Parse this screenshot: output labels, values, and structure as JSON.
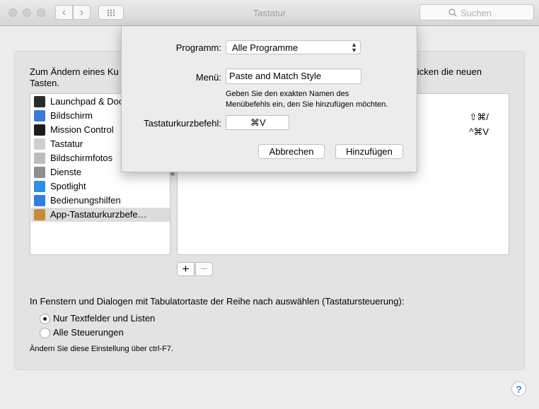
{
  "window": {
    "title": "Tastatur",
    "search_placeholder": "Suchen",
    "back_glyph": "‹",
    "forward_glyph": "›"
  },
  "intro": {
    "text_left": "Zum Ändern eines Ku",
    "text_second_line": "Tasten.",
    "text_right": "drücken die neuen"
  },
  "categories": [
    {
      "label": "Launchpad & Doc",
      "icon": "launchpad-dock-icon",
      "color": "#2b2b2b"
    },
    {
      "label": "Bildschirm",
      "icon": "display-icon",
      "color": "#3a7bd5"
    },
    {
      "label": "Mission Control",
      "icon": "mission-control-icon",
      "color": "#1c1c1c"
    },
    {
      "label": "Tastatur",
      "icon": "keyboard-icon",
      "color": "#cfcfcf"
    },
    {
      "label": "Bildschirmfotos",
      "icon": "screenshot-icon",
      "color": "#bdbdbd"
    },
    {
      "label": "Dienste",
      "icon": "services-gear-icon",
      "color": "#8e8e8e"
    },
    {
      "label": "Spotlight",
      "icon": "spotlight-icon",
      "color": "#2f8de4"
    },
    {
      "label": "Bedienungshilfen",
      "icon": "accessibility-icon",
      "color": "#2f7fe0"
    },
    {
      "label": "App-Tastaturkurzbefe…",
      "icon": "app-shortcuts-icon",
      "color": "#c98a3a"
    }
  ],
  "shortcuts": [
    "⇧⌘/",
    "^⌘V"
  ],
  "buttons": {
    "add": "+",
    "remove": "−",
    "help": "?"
  },
  "tab_navigation": {
    "title": "In Fenstern und Dialogen mit Tabulatortaste der Reihe nach auswählen (Tastatursteuerung):",
    "options": [
      {
        "label": "Nur Textfelder und Listen",
        "selected": true
      },
      {
        "label": "Alle Steuerungen",
        "selected": false
      }
    ],
    "hint": "Ändern Sie diese Einstellung über ctrl-F7."
  },
  "sheet": {
    "program_label": "Programm:",
    "program_value": "Alle Programme",
    "menu_label": "Menü:",
    "menu_value": "Paste and Match Style",
    "description_line1": "Geben Sie den exakten Namen des",
    "description_line2": "Menübefehls ein, den Sie hinzufügen möchten.",
    "shortcut_label": "Tastaturkurzbefehl:",
    "shortcut_value": "⌘V",
    "cancel_label": "Abbrechen",
    "add_label": "Hinzufügen"
  }
}
